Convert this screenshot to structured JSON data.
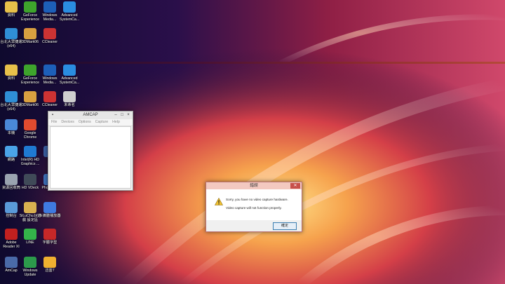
{
  "desktop": {
    "icons": [
      {
        "label": "資料",
        "color": "#e8c14a"
      },
      {
        "label": "GeForce Experience",
        "color": "#3ea42c"
      },
      {
        "label": "Windows Media...",
        "color": "#1d5fb8"
      },
      {
        "label": "Advanced SystemCa...",
        "color": "#2a8de0"
      },
      {
        "label": "台北大眾捷運(x64)",
        "color": "#2f8fd6"
      },
      {
        "label": "3DMark06",
        "color": "#d8a040"
      },
      {
        "label": "CCleaner",
        "color": "#cc3333"
      },
      {
        "label": "資料",
        "color": "#e8c14a"
      },
      {
        "label": "GeForce Experience",
        "color": "#3ea42c"
      },
      {
        "label": "Windows Media...",
        "color": "#1d5fb8"
      },
      {
        "label": "Advanced SystemCa...",
        "color": "#2a8de0"
      },
      {
        "label": "台北大眾捷運(x64)",
        "color": "#2f8fd6"
      },
      {
        "label": "3DMark06",
        "color": "#d8a040"
      },
      {
        "label": "CCleaner",
        "color": "#cc3333"
      },
      {
        "label": "未命名",
        "color": "#cfcfcf"
      },
      {
        "label": "本機",
        "color": "#4a88d8"
      },
      {
        "label": "Google Chrome",
        "color": "#e04b2f"
      },
      {
        "label": "網路",
        "color": "#4aa3e8"
      },
      {
        "label": "Intel(R) HD Graphics ...",
        "color": "#1f7ad2"
      },
      {
        "label": "Ba",
        "color": "#3a5fa0"
      },
      {
        "label": "資源回收筒",
        "color": "#9aa4b0"
      },
      {
        "label": "HD VDeck",
        "color": "#404a58"
      },
      {
        "label": "PhotoCap",
        "color": "#3d70b8"
      },
      {
        "label": "控制台",
        "color": "#5a9ad8"
      },
      {
        "label": "SiLuChu.bl遊戲 設定區",
        "color": "#d8b050"
      },
      {
        "label": "多媒體播放器",
        "color": "#3f7ae0"
      },
      {
        "label": "Adobe Reader XI",
        "color": "#c2201f"
      },
      {
        "label": "LINE",
        "color": "#34b34a"
      },
      {
        "label": "字體字型",
        "color": "#c62828"
      },
      {
        "label": "AmCap",
        "color": "#4a6aa8"
      },
      {
        "label": "Windows Update",
        "color": "#2c9a4b"
      },
      {
        "label": "迅雷7",
        "color": "#f0b030"
      }
    ]
  },
  "amcap": {
    "title": "AMCAP",
    "menu": [
      "File",
      "Devices",
      "Options",
      "Capture",
      "Help"
    ]
  },
  "dialog": {
    "title": "錯誤",
    "message1": "Sorry, you have no video capture hardware.",
    "message2": "Video capture will not function properly.",
    "ok_label": "確定"
  }
}
